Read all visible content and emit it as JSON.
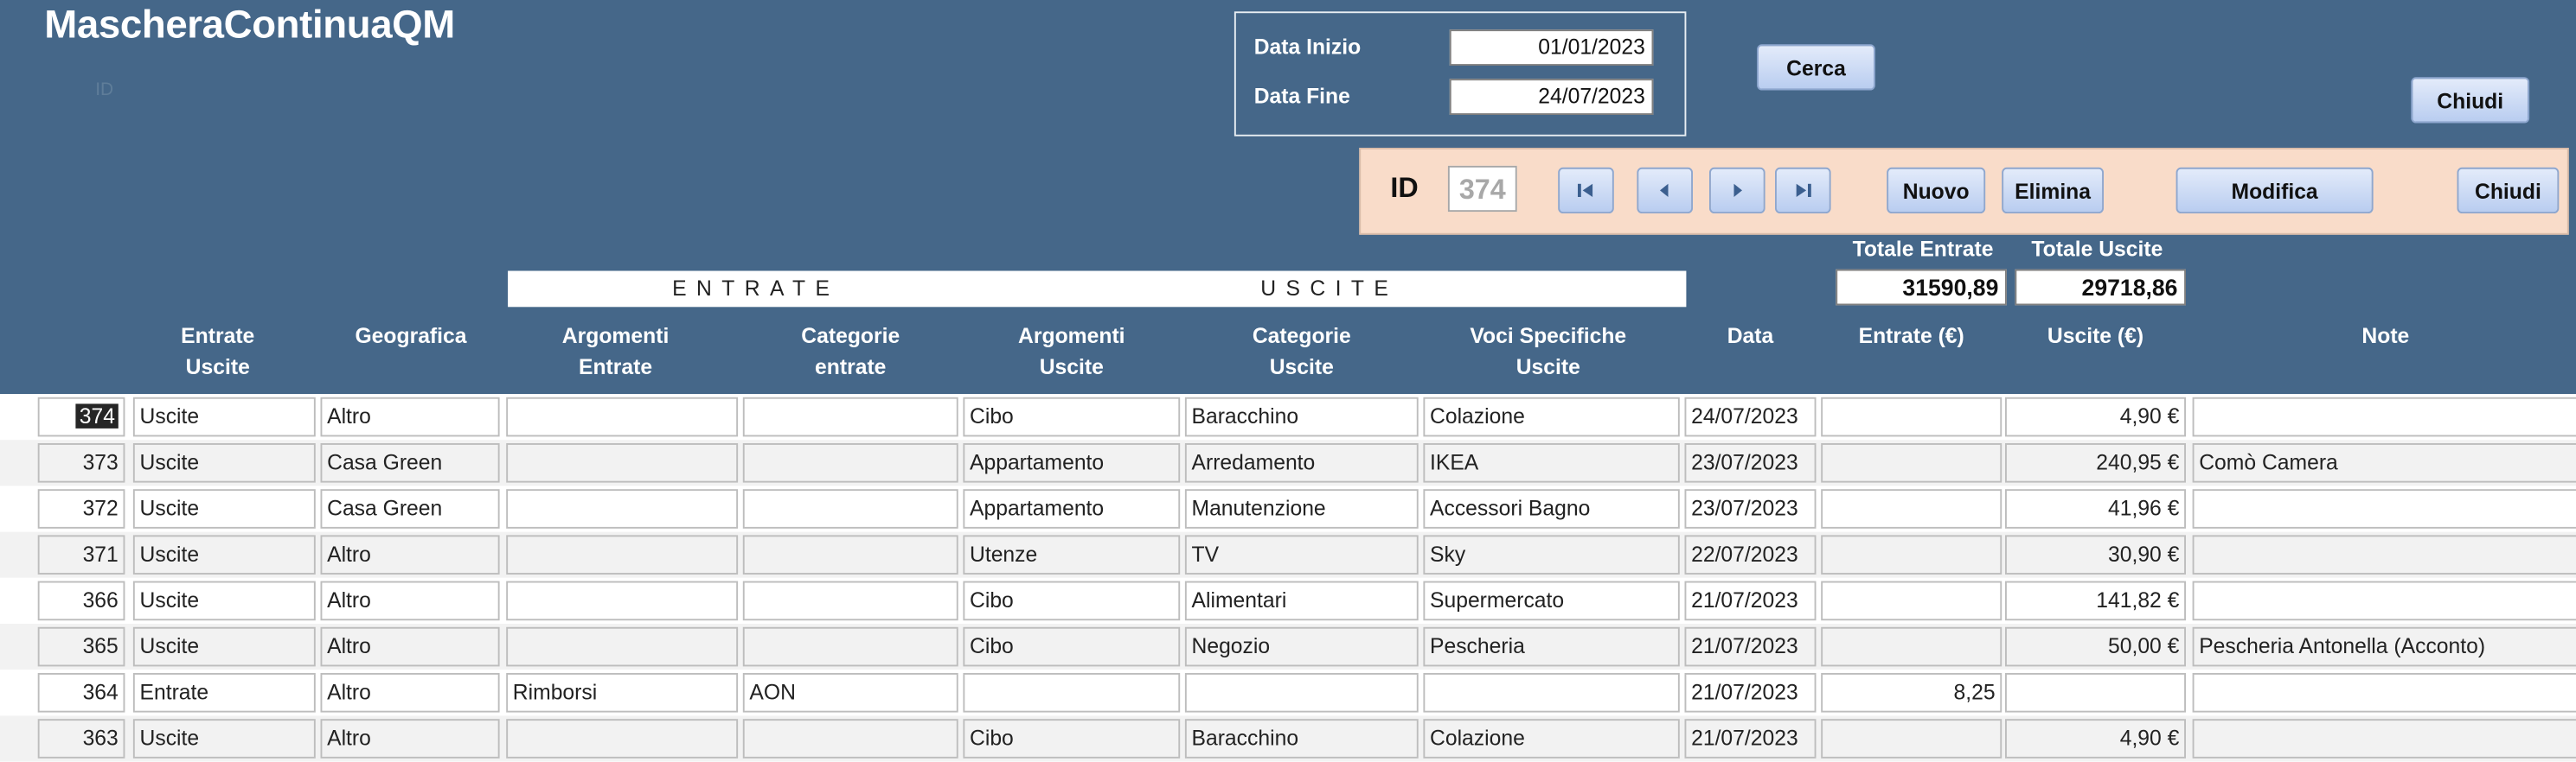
{
  "app": {
    "title": "MascheraContinuaQM",
    "ghost_label": "ID"
  },
  "filter": {
    "start_label": "Data Inizio",
    "start_value": "01/01/2023",
    "end_label": "Data Fine",
    "end_value": "24/07/2023",
    "search_label": "Cerca",
    "close_label": "Chiudi"
  },
  "nav": {
    "id_label": "ID",
    "id_value": "374",
    "new_label": "Nuovo",
    "delete_label": "Elimina",
    "edit_label": "Modifica",
    "close_label": "Chiudi"
  },
  "bands": {
    "entrate": "ENTRATE",
    "uscite": "USCITE"
  },
  "totals": {
    "entrate_label": "Totale Entrate",
    "entrate_value": "31590,89",
    "uscite_label": "Totale Uscite",
    "uscite_value": "29718,86"
  },
  "columns": {
    "entrate_uscite_1": "Entrate",
    "entrate_uscite_2": "Uscite",
    "geografica": "Geografica",
    "arg_entrate_1": "Argomenti",
    "arg_entrate_2": "Entrate",
    "cat_entrate_1": "Categorie",
    "cat_entrate_2": "entrate",
    "arg_uscite_1": "Argomenti",
    "arg_uscite_2": "Uscite",
    "cat_uscite_1": "Categorie",
    "cat_uscite_2": "Uscite",
    "voci_1": "Voci Specifiche",
    "voci_2": "Uscite",
    "data": "Data",
    "entrate_eur": "Entrate (€)",
    "uscite_eur": "Uscite (€)",
    "note": "Note"
  },
  "rows": [
    {
      "id": "374",
      "tipo": "Uscite",
      "geo": "Altro",
      "arg_e": "",
      "cat_e": "",
      "arg_u": "Cibo",
      "cat_u": "Baracchino",
      "voce": "Colazione",
      "data": "24/07/2023",
      "entrate": "",
      "uscite": "4,90 €",
      "note": ""
    },
    {
      "id": "373",
      "tipo": "Uscite",
      "geo": "Casa Green",
      "arg_e": "",
      "cat_e": "",
      "arg_u": "Appartamento",
      "cat_u": "Arredamento",
      "voce": "IKEA",
      "data": "23/07/2023",
      "entrate": "",
      "uscite": "240,95 €",
      "note": "Comò Camera"
    },
    {
      "id": "372",
      "tipo": "Uscite",
      "geo": "Casa Green",
      "arg_e": "",
      "cat_e": "",
      "arg_u": "Appartamento",
      "cat_u": "Manutenzione",
      "voce": "Accessori Bagno",
      "data": "23/07/2023",
      "entrate": "",
      "uscite": "41,96 €",
      "note": ""
    },
    {
      "id": "371",
      "tipo": "Uscite",
      "geo": "Altro",
      "arg_e": "",
      "cat_e": "",
      "arg_u": "Utenze",
      "cat_u": "TV",
      "voce": "Sky",
      "data": "22/07/2023",
      "entrate": "",
      "uscite": "30,90 €",
      "note": ""
    },
    {
      "id": "366",
      "tipo": "Uscite",
      "geo": "Altro",
      "arg_e": "",
      "cat_e": "",
      "arg_u": "Cibo",
      "cat_u": "Alimentari",
      "voce": "Supermercato",
      "data": "21/07/2023",
      "entrate": "",
      "uscite": "141,82 €",
      "note": ""
    },
    {
      "id": "365",
      "tipo": "Uscite",
      "geo": "Altro",
      "arg_e": "",
      "cat_e": "",
      "arg_u": "Cibo",
      "cat_u": "Negozio",
      "voce": "Pescheria",
      "data": "21/07/2023",
      "entrate": "",
      "uscite": "50,00 €",
      "note": "Pescheria Antonella (Acconto)"
    },
    {
      "id": "364",
      "tipo": "Entrate",
      "geo": "Altro",
      "arg_e": "Rimborsi",
      "cat_e": "AON",
      "arg_u": "",
      "cat_u": "",
      "voce": "",
      "data": "21/07/2023",
      "entrate": "8,25",
      "uscite": "",
      "note": ""
    },
    {
      "id": "363",
      "tipo": "Uscite",
      "geo": "Altro",
      "arg_e": "",
      "cat_e": "",
      "arg_u": "Cibo",
      "cat_u": "Baracchino",
      "voce": "Colazione",
      "data": "21/07/2023",
      "entrate": "",
      "uscite": "4,90 €",
      "note": ""
    }
  ]
}
